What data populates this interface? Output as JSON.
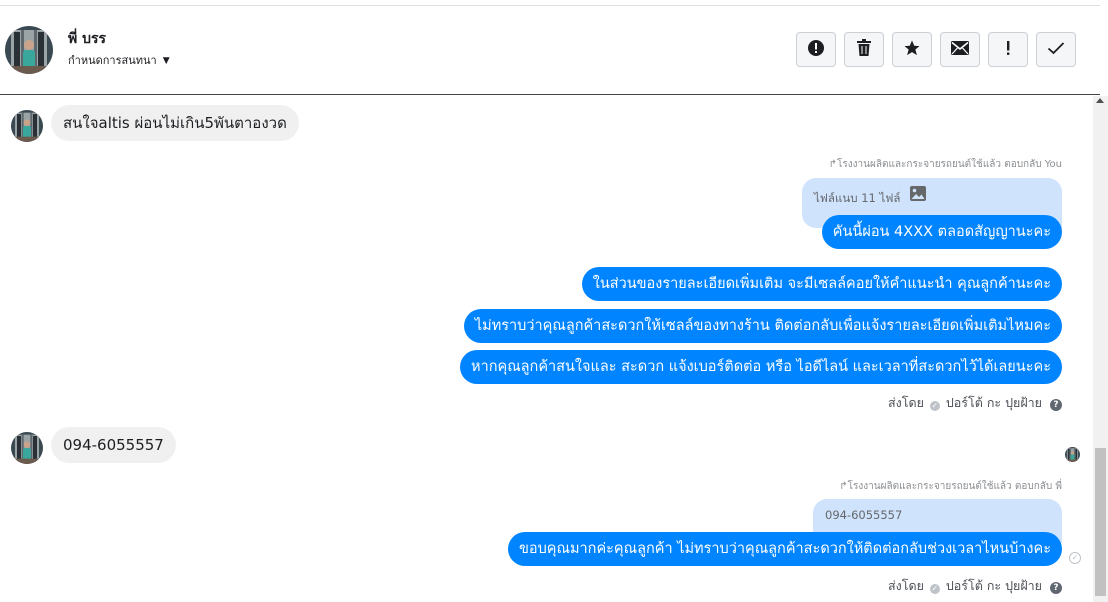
{
  "header": {
    "name": "พี่ บรร",
    "subtitle": "กำหนดการสนทนา",
    "toolbar": [
      {
        "icon": "alert-circle-icon",
        "glyph": "!"
      },
      {
        "icon": "trash-icon",
        "glyph": "🗑"
      },
      {
        "icon": "star-icon",
        "glyph": "★"
      },
      {
        "icon": "envelope-icon",
        "glyph": "✉"
      },
      {
        "icon": "exclamation-icon",
        "glyph": "!"
      },
      {
        "icon": "check-icon",
        "glyph": "✓"
      }
    ]
  },
  "messages": {
    "incoming_1": "สนใจaltis ผ่อนไม่เกิน5พันตาองวด",
    "reply_meta_1": "↱โรงงานผลิตและกระจายรถยนต์ใช้แล้ว ตอบกลับ You",
    "reply_quote_1": "ไฟล์แนบ 11 ไฟล์",
    "outgoing_1": "คันนี้ผ่อน 4XXX ตลอดสัญญานะคะ",
    "outgoing_2": "ในส่วนของรายละเอียดเพิ่มเติม จะมีเซลล์คอยให้คำแนะนำ คุณลูกค้านะคะ",
    "outgoing_3": "ไม่ทราบว่าคุณลูกค้าสะดวกให้เซลล์ของทางร้าน ติดต่อกลับเพื่อแจ้งรายละเอียดเพิ่มเติมไหมคะ",
    "outgoing_4": "หากคุณลูกค้าสนใจและ สะดวก แจ้งเบอร์ติดต่อ หรือ ไอดีไลน์ และเวลาที่สะดวกไว้ได้เลยนะคะ",
    "sent_by_1_prefix": "ส่งโดย",
    "sent_by_1_name": "ปอร์โต้ กะ ปุยฝ้าย",
    "incoming_2": "094-6055557",
    "reply_meta_2": "↱โรงงานผลิตและกระจายรถยนต์ใช้แล้ว ตอบกลับ พี่",
    "reply_quote_2": "094-6055557",
    "outgoing_5": "ขอบคุณมากค่ะคุณลูกค้า ไม่ทราบว่าคุณลูกค้าสะดวกให้ติดต่อกลับช่วงเวลาไหนบ้างคะ",
    "sent_by_2_prefix": "ส่งโดย",
    "sent_by_2_name": "ปอร์โต้ กะ ปุยฝ้าย"
  },
  "colors": {
    "outgoing_bubble": "#0084ff",
    "incoming_bubble": "#f0f0f0",
    "reply_quote_bg": "#cfe3fc"
  }
}
